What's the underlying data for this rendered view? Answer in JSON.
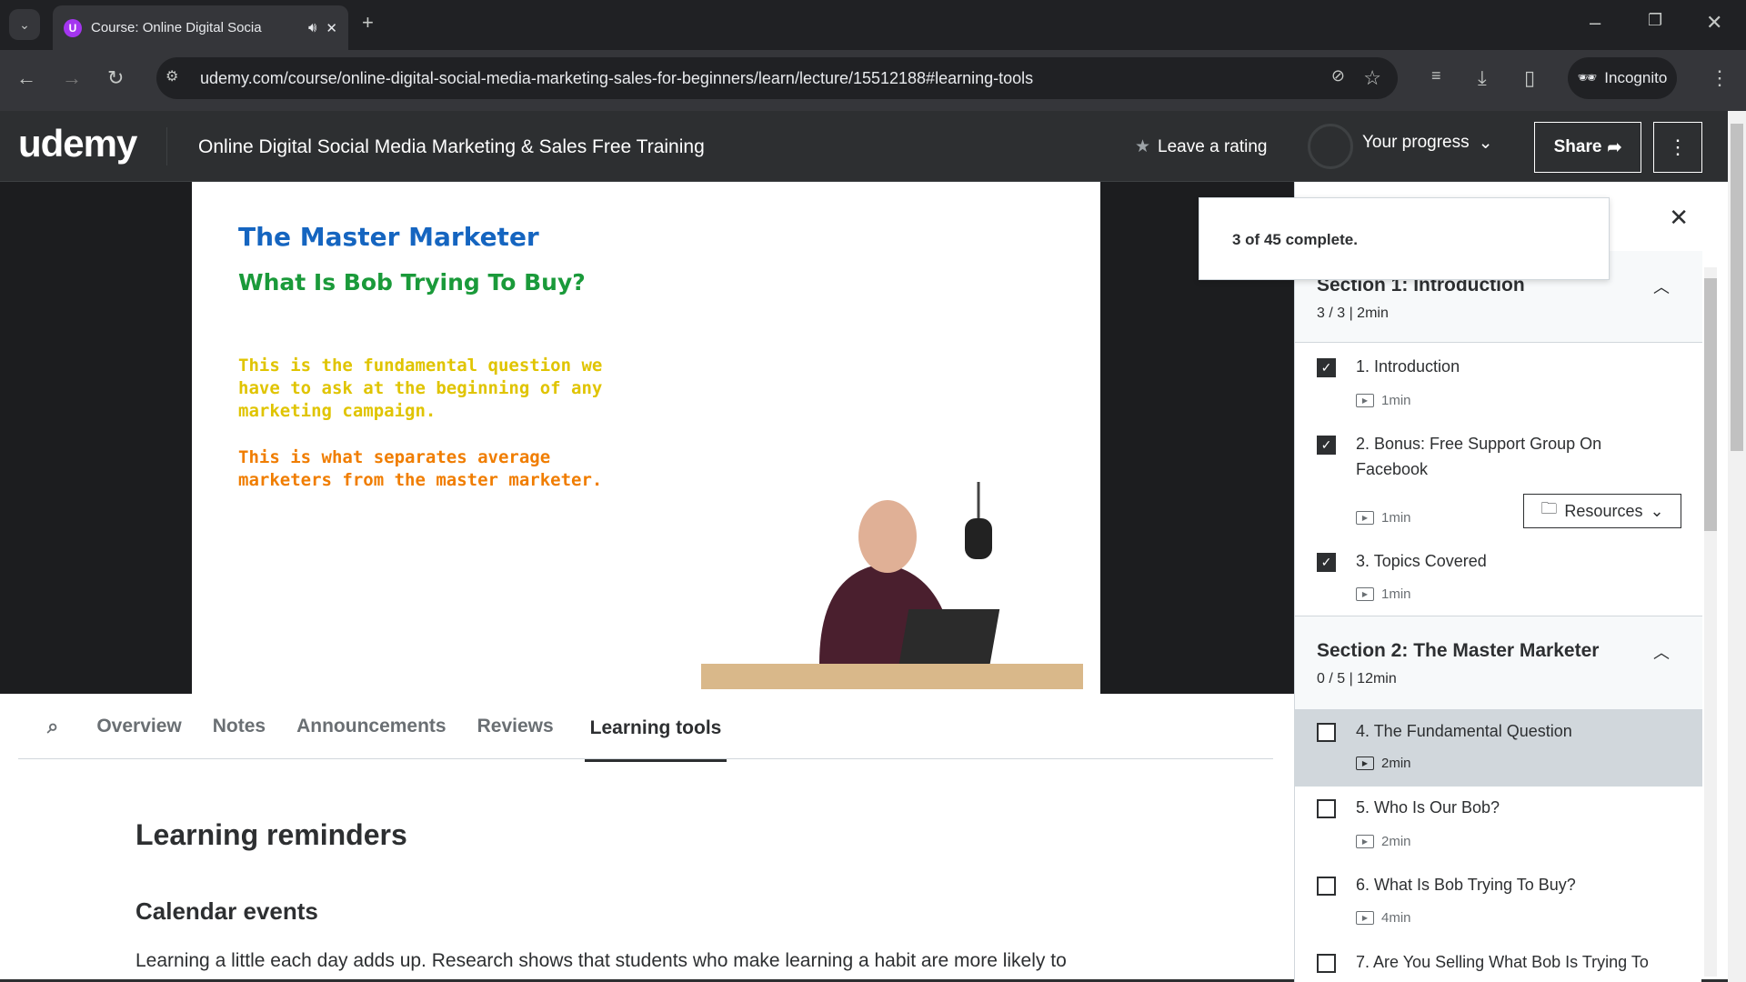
{
  "browser": {
    "tab_title": "Course: Online Digital Socia",
    "url": "udemy.com/course/online-digital-social-media-marketing-sales-for-beginners/learn/lecture/15512188#learning-tools",
    "incognito_label": "Incognito"
  },
  "header": {
    "logo": "udemy",
    "course_title": "Online Digital Social Media Marketing & Sales Free Training",
    "rating_label": "Leave a rating",
    "progress_label": "Your progress",
    "share_label": "Share"
  },
  "slide": {
    "title": "The Master Marketer",
    "subtitle": "What Is Bob Trying To Buy?",
    "para1": [
      "This is the fundamental question we",
      "have to ask at the beginning of any",
      "marketing campaign."
    ],
    "para2": [
      "This is what separates average",
      "marketers from the master marketer."
    ]
  },
  "tabs": [
    "Overview",
    "Notes",
    "Announcements",
    "Reviews",
    "Learning tools"
  ],
  "active_tab": "Learning tools",
  "content": {
    "heading": "Learning reminders",
    "subheading": "Calendar events",
    "paragraph": "Learning a little each day adds up. Research shows that students who make learning a habit are more likely to"
  },
  "progress_popup": {
    "text": "3 of 45 complete.",
    "completed": 3,
    "total": 45
  },
  "sidebar": {
    "sections": [
      {
        "title": "Section 1: Introduction",
        "meta": "3 / 3 | 2min",
        "items": [
          {
            "title": "1. Introduction",
            "duration": "1min",
            "done": true
          },
          {
            "title": "2. Bonus: Free Support Group On Facebook",
            "duration": "1min",
            "done": true,
            "resources_label": "Resources"
          },
          {
            "title": "3. Topics Covered",
            "duration": "1min",
            "done": true
          }
        ]
      },
      {
        "title": "Section 2: The Master Marketer",
        "meta": "0 / 5 | 12min",
        "items": [
          {
            "title": "4. The Fundamental Question",
            "duration": "2min",
            "done": false,
            "current": true
          },
          {
            "title": "5. Who Is Our Bob?",
            "duration": "2min",
            "done": false
          },
          {
            "title": "6. What Is Bob Trying To Buy?",
            "duration": "4min",
            "done": false
          },
          {
            "title": "7. Are You Selling What Bob Is Trying To",
            "done": false
          }
        ]
      }
    ]
  },
  "colors": {
    "brand": "#a435f0",
    "header_bg": "#2d2f31",
    "slide_title": "#1565c0",
    "slide_subtitle": "#1a9a3a",
    "slide_para1": "#e0c400",
    "slide_para2": "#f07d00"
  }
}
